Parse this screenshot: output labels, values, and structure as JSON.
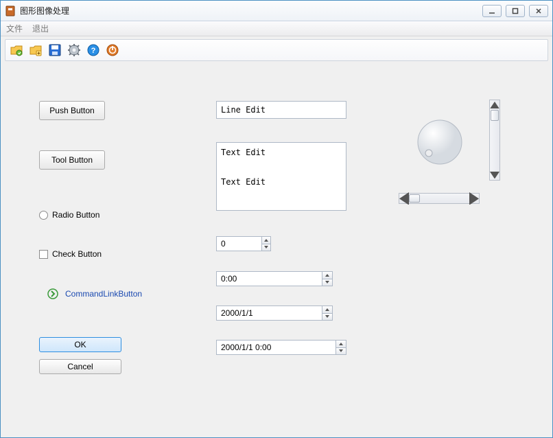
{
  "window": {
    "title": "图形图像处理"
  },
  "menu": {
    "file": "文件",
    "quit": "退出"
  },
  "toolbar_icons": [
    "folder-reload-icon",
    "folder-plus-icon",
    "save-icon",
    "gear-icon",
    "help-icon",
    "power-icon"
  ],
  "buttons": {
    "push": "Push Button",
    "tool": "Tool Button",
    "radio": "Radio Button",
    "check": "Check Button",
    "cmdlink": "CommandLinkButton",
    "ok": "OK",
    "cancel": "Cancel"
  },
  "inputs": {
    "line_edit": "Line Edit",
    "text_edit": "Text Edit\n\nText Edit",
    "spin_int": "0",
    "time": "0:00",
    "date": "2000/1/1",
    "datetime": "2000/1/1 0:00"
  },
  "dial": {
    "value": 0
  },
  "hscroll": {
    "value": 0,
    "max": 100
  },
  "vscroll": {
    "value": 0,
    "max": 100
  }
}
